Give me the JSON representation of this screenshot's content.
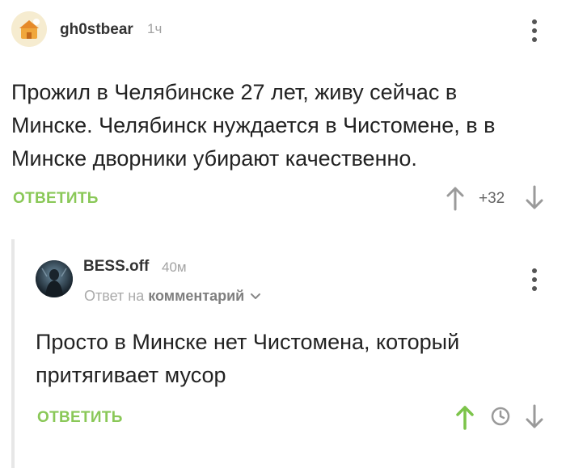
{
  "comments": [
    {
      "username": "gh0stbear",
      "time": "1ч",
      "text_lines": [
        "Прожил в Челябинске 27 лет, живу сейчас в",
        "Минске. Челябинск нуждается в Чистомене, в в",
        "Минске дворники убирают качественно."
      ],
      "reply_label": "ОТВЕТИТЬ",
      "rating": "+32",
      "upvote_color": "#9a9a9a"
    },
    {
      "username": "BESS.off",
      "time": "40м",
      "reply_to_prefix": "Ответ на",
      "reply_to_link": "комментарий",
      "text_lines": [
        "Просто в Минске нет Чистомена, который",
        "притягивает мусор"
      ],
      "reply_label": "ОТВЕТИТЬ",
      "upvote_color": "#7cc44a"
    }
  ],
  "colors": {
    "accent_green": "#8ac858",
    "thread_line": "#e7e7e7"
  },
  "icons": [
    "arrow-up-icon",
    "arrow-down-icon",
    "clock-icon",
    "kebab-menu-icon",
    "chevron-down-icon"
  ]
}
